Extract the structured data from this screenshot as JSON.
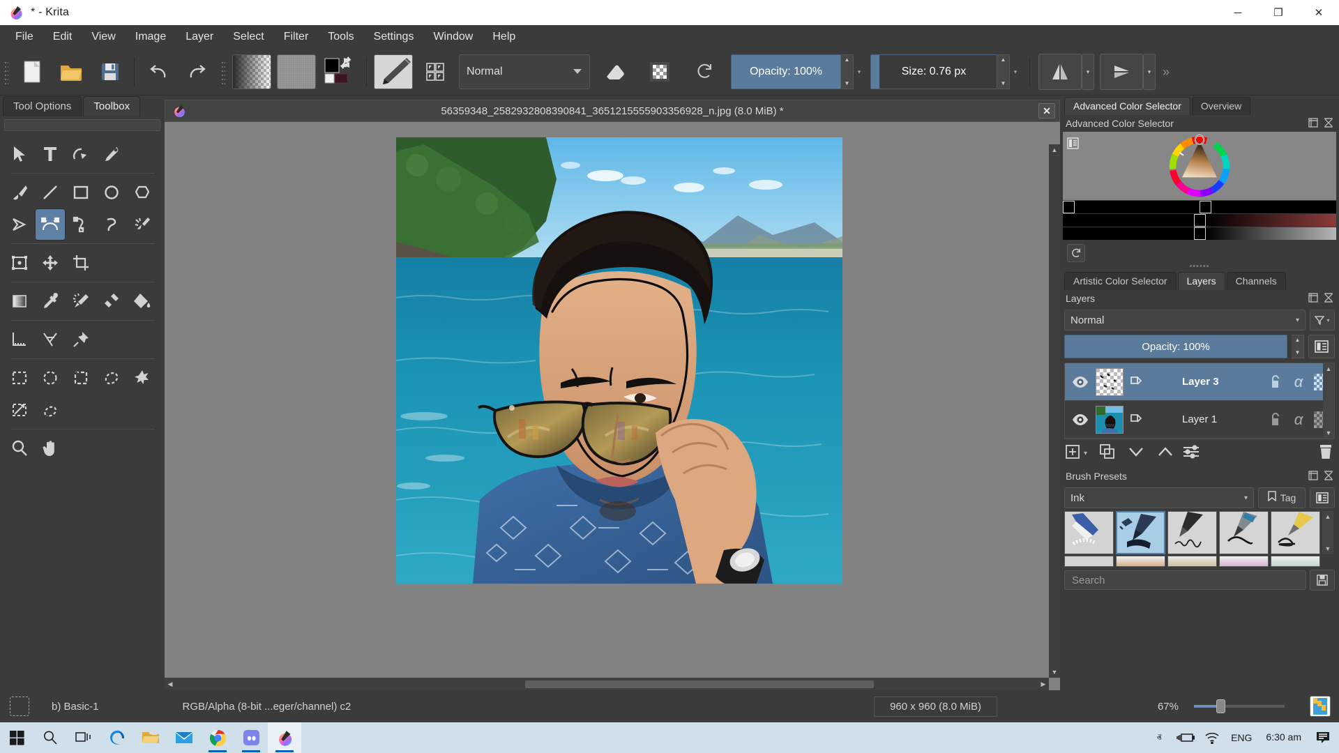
{
  "window": {
    "title": "* - Krita",
    "app_icon": "krita-logo-icon",
    "controls": [
      {
        "name": "minimize-button",
        "glyph": "─"
      },
      {
        "name": "maximize-button",
        "glyph": "❐"
      },
      {
        "name": "close-button",
        "glyph": "✕"
      }
    ]
  },
  "menubar": {
    "items": [
      {
        "label": "File"
      },
      {
        "label": "Edit"
      },
      {
        "label": "View"
      },
      {
        "label": "Image"
      },
      {
        "label": "Layer"
      },
      {
        "label": "Select"
      },
      {
        "label": "Filter"
      },
      {
        "label": "Tools"
      },
      {
        "label": "Settings"
      },
      {
        "label": "Window"
      },
      {
        "label": "Help"
      }
    ]
  },
  "toolbar": {
    "new_label": "new-file-icon",
    "open_label": "open-folder-icon",
    "save_label": "save-disk-icon",
    "undo_label": "undo-arrow-icon",
    "redo_label": "redo-arrow-icon",
    "gradient_label": "gradient-swatch",
    "pattern_label": "pattern-swatch",
    "fgbg_label": "foreground-background-colors",
    "brush_preset_label": "brush-preset-thumbnail",
    "brush_editor_label": "brush-editor-icon",
    "blend_mode": "Normal",
    "eraser_label": "eraser-toggle-icon",
    "alpha_lock_label": "alpha-lock-icon",
    "reload_label": "reload-preset-icon",
    "opacity_label": "Opacity: 100%",
    "size_label": "Size: 0.76 px",
    "mirror_h_label": "mirror-horizontal-icon",
    "mirror_v_label": "mirror-vertical-icon",
    "overflow_label": "»"
  },
  "left_dock": {
    "tabs": [
      {
        "label": "Tool Options",
        "active": false
      },
      {
        "label": "Toolbox",
        "active": true
      }
    ],
    "tools": [
      [
        {
          "name": "select-shapes-tool",
          "glyph": "arrow"
        },
        {
          "name": "text-tool",
          "glyph": "T"
        },
        {
          "name": "edit-shapes-tool",
          "glyph": "editshape"
        },
        {
          "name": "calligraphy-tool",
          "glyph": "calligraphy"
        }
      ],
      [
        {
          "name": "freehand-brush-tool",
          "glyph": "brush"
        },
        {
          "name": "line-tool",
          "glyph": "line"
        },
        {
          "name": "rectangle-tool",
          "glyph": "rect"
        },
        {
          "name": "ellipse-tool",
          "glyph": "ellipse"
        },
        {
          "name": "polygon-tool",
          "glyph": "polygon"
        }
      ],
      [
        {
          "name": "polyline-tool",
          "glyph": "polyline"
        },
        {
          "name": "bezier-curve-tool",
          "glyph": "bezier",
          "active": true
        },
        {
          "name": "freehand-path-tool",
          "glyph": "freehandpath"
        },
        {
          "name": "dynamic-brush-tool",
          "glyph": "dynamic"
        },
        {
          "name": "multibrush-tool",
          "glyph": "multibrush"
        }
      ],
      [
        {
          "name": "transform-tool",
          "glyph": "transform"
        },
        {
          "name": "move-tool",
          "glyph": "move"
        },
        {
          "name": "crop-tool",
          "glyph": "crop"
        }
      ],
      [
        {
          "name": "gradient-tool",
          "glyph": "gradient"
        },
        {
          "name": "color-sampler-tool",
          "glyph": "eyedropper"
        },
        {
          "name": "colorize-mask-tool",
          "glyph": "colorize"
        },
        {
          "name": "smart-patch-tool",
          "glyph": "smartpatch"
        },
        {
          "name": "fill-tool",
          "glyph": "fill"
        }
      ],
      [
        {
          "name": "measure-tool",
          "glyph": "measure"
        },
        {
          "name": "assistant-tool",
          "glyph": "assistant"
        },
        {
          "name": "reference-images-tool",
          "glyph": "pin"
        }
      ],
      [
        {
          "name": "rectangular-selection-tool",
          "glyph": "rectselect"
        },
        {
          "name": "elliptical-selection-tool",
          "glyph": "ellipseselect"
        },
        {
          "name": "polygonal-selection-tool",
          "glyph": "polyselect"
        },
        {
          "name": "freehand-selection-tool",
          "glyph": "freeselect"
        },
        {
          "name": "contiguous-selection-tool",
          "glyph": "magicwand"
        }
      ],
      [
        {
          "name": "similar-color-selection-tool",
          "glyph": "similarselect"
        },
        {
          "name": "bezier-selection-tool",
          "glyph": "bezierselect"
        }
      ],
      [
        {
          "name": "zoom-tool",
          "glyph": "zoom"
        },
        {
          "name": "pan-tool",
          "glyph": "hand"
        }
      ]
    ]
  },
  "canvas": {
    "document_title": "56359348_2582932808390841_3651215555903356928_n.jpg (8.0 MiB) *",
    "close_label": "✕",
    "doc_icon": "krita-document-icon"
  },
  "right_dock": {
    "top_tabs": [
      {
        "label": "Advanced Color Selector",
        "active": true
      },
      {
        "label": "Overview",
        "active": false
      }
    ],
    "color_selector": {
      "panel_title": "Advanced Color Selector",
      "settings_icon": "selector-settings-icon",
      "reset_icon": "reset-color-icon",
      "float_icon": "float-panel-icon",
      "close_icon": "close-panel-icon"
    },
    "mid_tabs": [
      {
        "label": "Artistic Color Selector",
        "active": false
      },
      {
        "label": "Layers",
        "active": true
      },
      {
        "label": "Channels",
        "active": false
      }
    ],
    "layers": {
      "panel_title": "Layers",
      "blend_mode": "Normal",
      "filter_icon": "layer-filter-icon",
      "opacity_label": "Opacity:  100%",
      "properties_icon": "layer-properties-icon",
      "rows": [
        {
          "name": "Layer 3",
          "selected": true,
          "visible": true,
          "thumb": "transparent-checker",
          "alpha_glyph": "α",
          "lock_icon": "lock-open-icon",
          "inherit_icon": "inherit-alpha-icon"
        },
        {
          "name": "Layer 1",
          "selected": false,
          "visible": true,
          "thumb": "photo",
          "alpha_glyph": "α",
          "lock_icon": "lock-open-icon",
          "inherit_icon": "inherit-alpha-icon"
        }
      ],
      "tools": [
        {
          "name": "add-layer-button",
          "glyph": "plus"
        },
        {
          "name": "add-layer-dropdown",
          "glyph": "caret"
        },
        {
          "name": "duplicate-layer-button",
          "glyph": "duplicate"
        },
        {
          "name": "move-layer-down-button",
          "glyph": "chevron-down"
        },
        {
          "name": "move-layer-up-button",
          "glyph": "chevron-up"
        },
        {
          "name": "layer-properties-button",
          "glyph": "sliders"
        },
        {
          "name": "delete-layer-button",
          "glyph": "trash"
        }
      ]
    },
    "brush_presets": {
      "panel_title": "Brush Presets",
      "tag_value": "Ink",
      "tag_button": "Tag",
      "tag_icon": "bookmark-icon",
      "view_icon": "list-view-icon",
      "search_placeholder": "Search",
      "save_icon": "save-preset-icon",
      "presets": [
        {
          "name": "ink-ballpoint",
          "selected": false,
          "color": "#3a5fa8"
        },
        {
          "name": "ink-gpen",
          "selected": true,
          "color": "#2b3a55"
        },
        {
          "name": "ink-fineliner",
          "selected": false,
          "color": "#2c2c2c"
        },
        {
          "name": "ink-brush-pen",
          "selected": false,
          "color": "#2f7fa8"
        },
        {
          "name": "ink-marker",
          "selected": false,
          "color": "#d8b game"
        }
      ]
    }
  },
  "statusbar": {
    "selection_icon": "selection-mask-icon",
    "brush_name": "b) Basic-1",
    "color_space": "RGB/Alpha (8-bit ...eger/channel)  c2",
    "dimensions": "960 x 960 (8.0 MiB)",
    "zoom_level": "67%",
    "preview_icon": "canvas-preview-icon"
  },
  "taskbar": {
    "items": [
      {
        "name": "start-button",
        "glyph": "windows"
      },
      {
        "name": "search-button",
        "glyph": "search"
      },
      {
        "name": "task-view-button",
        "glyph": "taskview"
      },
      {
        "name": "edge-button",
        "glyph": "edge"
      },
      {
        "name": "file-explorer-button",
        "glyph": "folder"
      },
      {
        "name": "mail-button",
        "glyph": "mail"
      },
      {
        "name": "chrome-button",
        "glyph": "chrome",
        "running": true
      },
      {
        "name": "discord-button",
        "glyph": "discord",
        "running": true
      },
      {
        "name": "krita-taskbar-button",
        "glyph": "krita",
        "running": true,
        "active": true
      }
    ],
    "tray": {
      "chevron": "ⱏ",
      "battery_icon": "battery-charging-icon",
      "wifi_icon": "wifi-icon",
      "language": "ENG",
      "time": "6:30 am",
      "notification_icon": "notification-icon"
    }
  }
}
